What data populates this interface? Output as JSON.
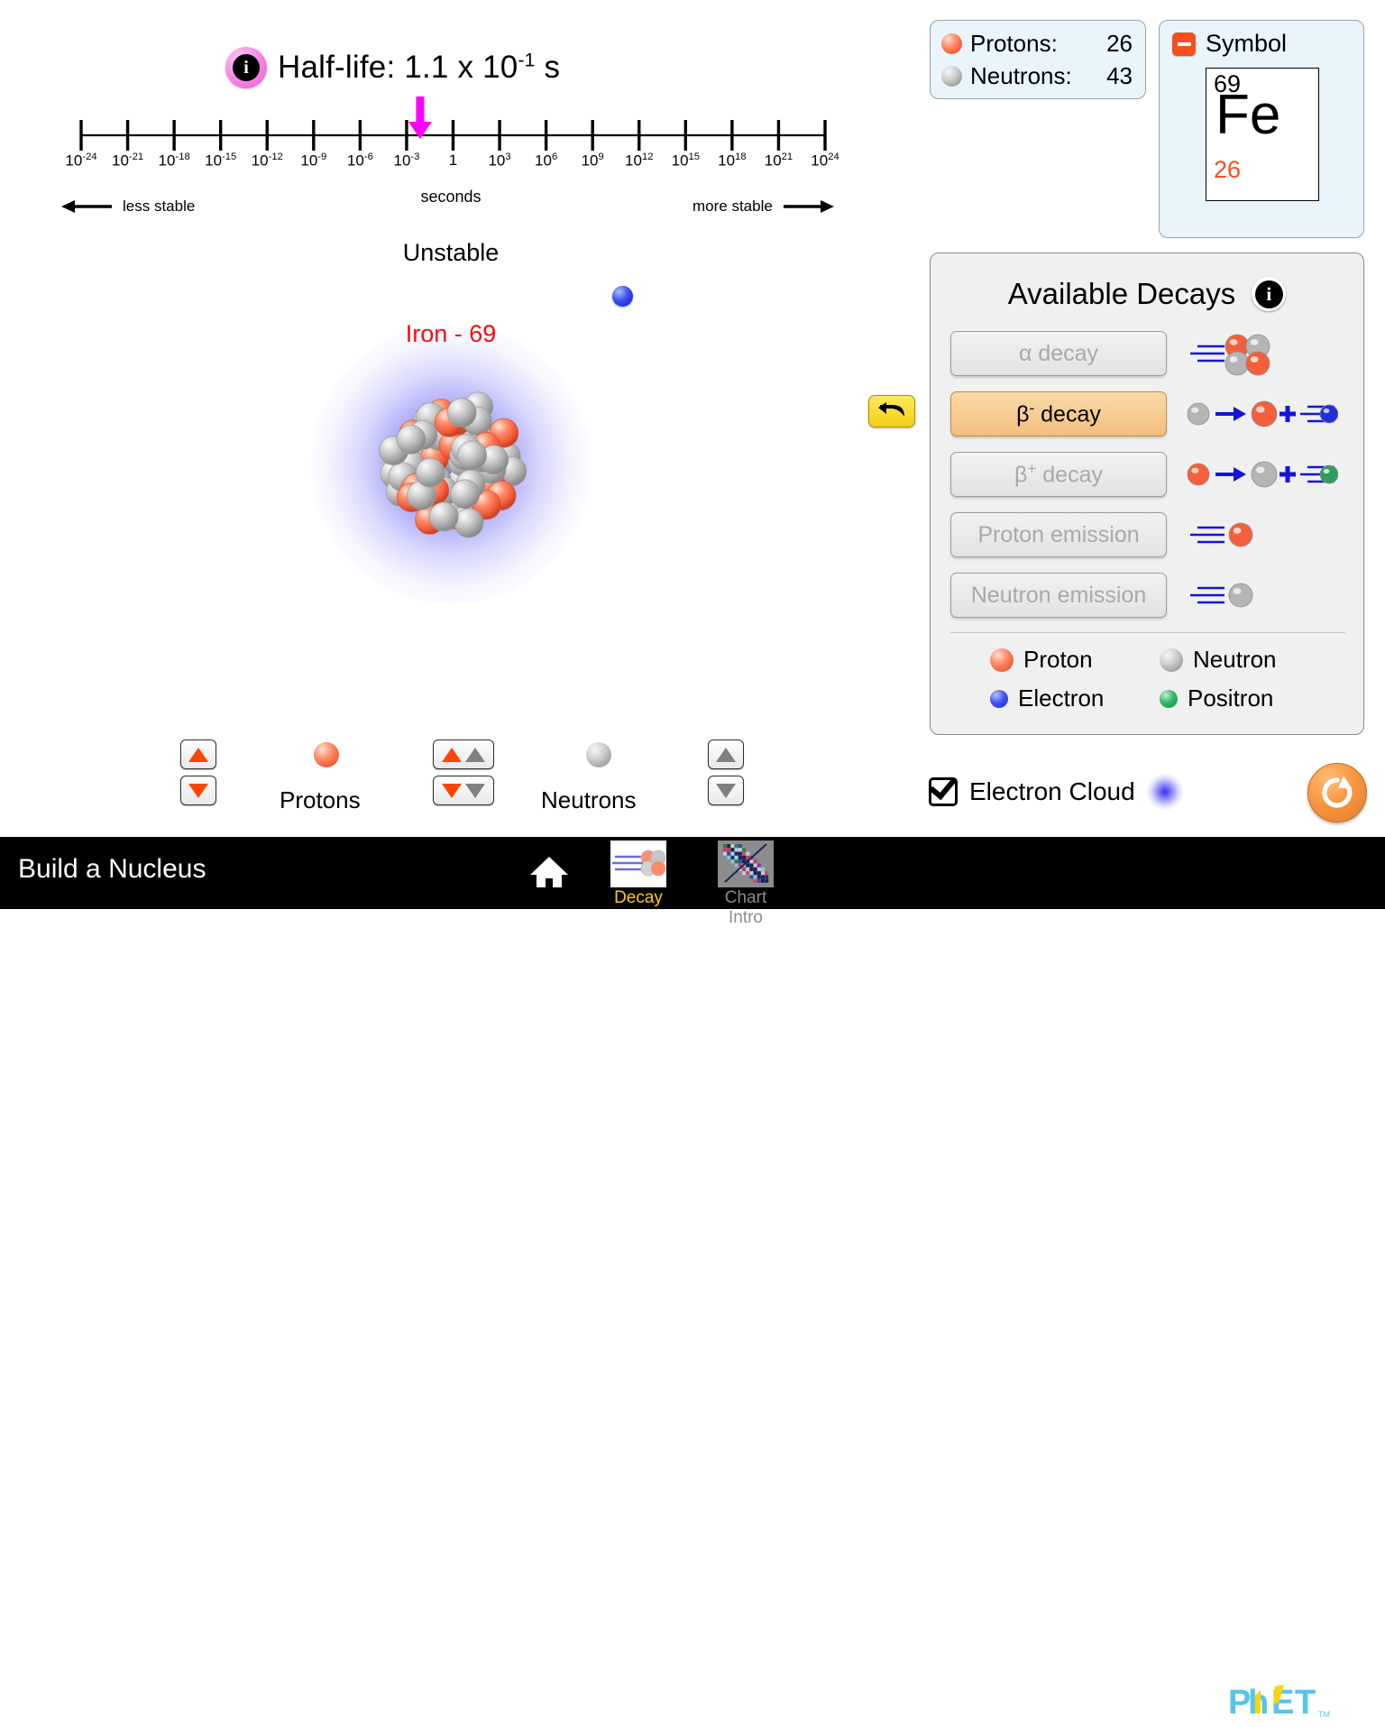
{
  "sim": {
    "title": "Build a Nucleus",
    "tabs": [
      {
        "id": "decay",
        "label": "Decay",
        "icon": "decay-tab-icon",
        "selected": true
      },
      {
        "id": "chart-intro",
        "label": "Chart Intro",
        "icon": "chart-intro-tab-icon",
        "selected": false
      }
    ],
    "home_icon": "home-icon",
    "gear_icon": "gear-icon",
    "keyboard_icon": "keyboard-icon",
    "kebab_icon": "kebab-menu-icon",
    "logo": "phet-logo"
  },
  "halflife": {
    "info_icon": "info-icon",
    "label": "Half-life:",
    "value_mantissa": "1.1 x 10",
    "value_exponent": "-1",
    "unit": "s",
    "full_text": "Half-life: 1.1 x 10-1 s",
    "axis_unit": "seconds",
    "less_stable": "less stable",
    "more_stable": "more stable",
    "arrow_color": "#ff00ff",
    "arrow_at_tick_index": 7,
    "ticks": [
      {
        "base": "10",
        "exp": "-24"
      },
      {
        "base": "10",
        "exp": "-21"
      },
      {
        "base": "10",
        "exp": "-18"
      },
      {
        "base": "10",
        "exp": "-15"
      },
      {
        "base": "10",
        "exp": "-12"
      },
      {
        "base": "10",
        "exp": "-9"
      },
      {
        "base": "10",
        "exp": "-6"
      },
      {
        "base": "10",
        "exp": "-3"
      },
      {
        "base": "1",
        "exp": ""
      },
      {
        "base": "10",
        "exp": "3"
      },
      {
        "base": "10",
        "exp": "6"
      },
      {
        "base": "10",
        "exp": "9"
      },
      {
        "base": "10",
        "exp": "12"
      },
      {
        "base": "10",
        "exp": "15"
      },
      {
        "base": "10",
        "exp": "18"
      },
      {
        "base": "10",
        "exp": "21"
      },
      {
        "base": "10",
        "exp": "24"
      }
    ]
  },
  "stage": {
    "stability": "Unstable",
    "nuclide": "Iron - 69",
    "nuclide_color": "#ff0000",
    "emitted_particle": "electron",
    "nucleus": {
      "protons": 26,
      "neutrons": 43
    }
  },
  "readout": {
    "protons_label": "Protons:",
    "protons_value": "26",
    "neutrons_label": "Neutrons:",
    "neutrons_value": "43",
    "proton_color": "#f4603c",
    "neutron_color": "#a6a6a6"
  },
  "symbol": {
    "title": "Symbol",
    "collapse_icon": "minus-icon",
    "mass_number": "69",
    "element": "Fe",
    "atomic_number": "26",
    "atomic_number_color": "#f4501e"
  },
  "decays": {
    "title": "Available Decays",
    "info_icon": "info-icon",
    "items": [
      {
        "id": "alpha",
        "label": "α decay",
        "sup": "",
        "enabled": false,
        "icon": "alpha-decay-icon"
      },
      {
        "id": "beta-minus",
        "label": "β decay",
        "sup": "-",
        "enabled": true,
        "icon": "beta-minus-decay-icon"
      },
      {
        "id": "beta-plus",
        "label": "β decay",
        "sup": "+",
        "enabled": false,
        "icon": "beta-plus-decay-icon"
      },
      {
        "id": "proton-emission",
        "label": "Proton emission",
        "sup": "",
        "enabled": false,
        "icon": "proton-emission-icon"
      },
      {
        "id": "neutron-emission",
        "label": "Neutron emission",
        "sup": "",
        "enabled": false,
        "icon": "neutron-emission-icon"
      }
    ],
    "legend": [
      {
        "id": "proton",
        "label": "Proton",
        "color": "#f4603c"
      },
      {
        "id": "neutron",
        "label": "Neutron",
        "color": "#a6a6a6"
      },
      {
        "id": "electron",
        "label": "Electron",
        "color": "#1a28cf"
      },
      {
        "id": "positron",
        "label": "Positron",
        "color": "#1f8f4c"
      }
    ]
  },
  "spinners": {
    "protons_label": "Protons",
    "neutrons_label": "Neutrons",
    "proton_arrow_color": "#ff4500",
    "neutron_arrow_color": "#808080"
  },
  "undo": {
    "icon": "undo-arrow-icon"
  },
  "bottom": {
    "electron_cloud_label": "Electron Cloud",
    "electron_cloud_checked": true,
    "reset_icon": "reset-all-icon",
    "reset_color": "#f79540"
  }
}
